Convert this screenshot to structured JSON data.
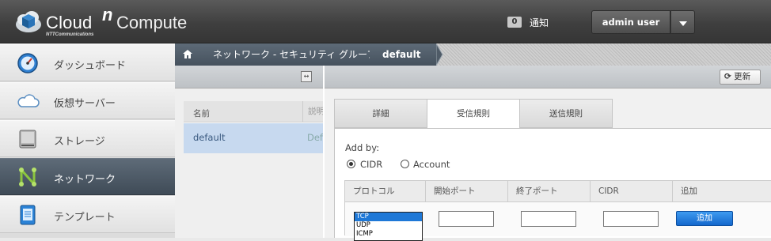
{
  "header": {
    "brand_cloud": "Cloud",
    "brand_n": "n",
    "brand_compute": "Compute",
    "brand_sub": "NTTCommunications",
    "notification_count": "0",
    "notification_label": "通知",
    "user_label": "admin user"
  },
  "sidebar": {
    "items": [
      {
        "label": "ダッシュボード",
        "icon": "dashboard-gauge-icon"
      },
      {
        "label": "仮想サーバー",
        "icon": "cloud-icon"
      },
      {
        "label": "ストレージ",
        "icon": "hard-drive-icon"
      },
      {
        "label": "ネットワーク",
        "icon": "network-icon",
        "active": true
      },
      {
        "label": "テンプレート",
        "icon": "template-icon"
      }
    ]
  },
  "breadcrumb": {
    "home_icon": "home-icon",
    "section": "ネットワーク - セキュリティ グループ",
    "current": "default"
  },
  "list": {
    "columns": [
      "名前",
      "説明"
    ],
    "rows": [
      {
        "name": "default",
        "description": "Defa"
      }
    ]
  },
  "panel": {
    "refresh_label": "更新",
    "tabs": [
      "詳細",
      "受信規則",
      "送信規則"
    ],
    "active_tab": "受信規則",
    "add_by_label": "Add by:",
    "radio_cidr": "CIDR",
    "radio_account": "Account",
    "rule_columns": [
      "プロトコル",
      "開始ポート",
      "終了ポート",
      "CIDR",
      "追加"
    ],
    "protocol_options": [
      "TCP",
      "UDP",
      "ICMP"
    ],
    "selected_protocol": "TCP",
    "add_button": "追加"
  },
  "colors": {
    "accent_blue": "#1e78d7",
    "active_nav": "#4a5663",
    "selected_row": "#c7d9ef"
  }
}
